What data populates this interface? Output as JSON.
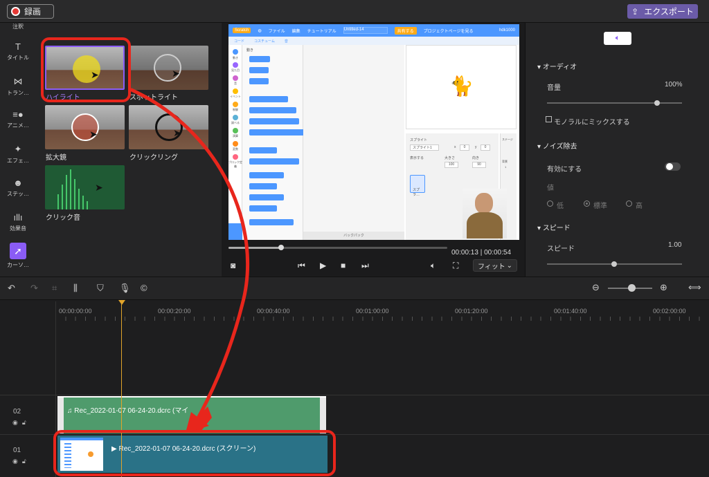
{
  "topbar": {
    "record_label": "録画",
    "export_label": "エクスポート"
  },
  "sidebar": {
    "items": [
      {
        "label": "注釈",
        "icon": "annotation-icon"
      },
      {
        "label": "タイトル",
        "icon": "title-icon"
      },
      {
        "label": "トラン…",
        "icon": "transition-icon"
      },
      {
        "label": "アニメ…",
        "icon": "animation-icon"
      },
      {
        "label": "エフェ…",
        "icon": "effect-icon"
      },
      {
        "label": "ステッ…",
        "icon": "sticker-icon"
      },
      {
        "label": "効果音",
        "icon": "sound-effect-icon"
      },
      {
        "label": "カーソ…",
        "icon": "cursor-icon"
      }
    ]
  },
  "effects": {
    "items": [
      {
        "label": "ハイライト",
        "selected": true
      },
      {
        "label": "スポットライト",
        "selected": false
      },
      {
        "label": "拡大鏡",
        "selected": false
      },
      {
        "label": "クリックリング",
        "selected": false
      },
      {
        "label": "クリック音",
        "selected": false
      }
    ]
  },
  "preview": {
    "scratch": {
      "menu": [
        "ファイル",
        "編集",
        "チュートリアル"
      ],
      "project_title": "Untitled-14",
      "share": "共有する",
      "see_project": "プロジェクトページを見る",
      "user": "hdk1000",
      "tabs": [
        "コード",
        "コスチューム",
        "音"
      ],
      "category_header": "動き",
      "categories": [
        "動き",
        "見た目",
        "音",
        "イベント",
        "制御",
        "調べる",
        "演算",
        "変数",
        "ブロック定義"
      ],
      "backpack": "バックパック",
      "sprite_label": "スプライト",
      "sprite_name": "スプライト1",
      "x_label": "x",
      "x_value": "0",
      "y_label": "y",
      "y_value": "0",
      "show_label": "表示する",
      "size_label": "大きさ",
      "size_value": "100",
      "direction_label": "向き",
      "direction_value": "90",
      "stage_label": "ステージ",
      "backdrop_label": "背景",
      "backdrop_count": "1",
      "thumb_name": "スプラ…"
    },
    "progress": 0.24,
    "time_current": "00:00:13",
    "time_total": "00:00:54",
    "fit_label": "フィット"
  },
  "props": {
    "audio_section": "オーディオ",
    "volume_label": "音量",
    "volume_value": "100%",
    "mono_label": "モノラルにミックスする",
    "noise_section": "ノイズ除去",
    "enable_label": "有効にする",
    "value_label": "値",
    "noise_options": [
      "低",
      "標準",
      "高"
    ],
    "speed_section": "スピード",
    "speed_label": "スピード",
    "speed_value": "1.00"
  },
  "timeline": {
    "ticks": [
      "00:00:00:00",
      "00:00:20:00",
      "00:00:40:00",
      "00:01:00:00",
      "00:01:20:00",
      "00:01:40:00",
      "00:02:00:00"
    ],
    "tracks": [
      {
        "number": "02",
        "clip_title": "Rec_2022-01-07 06-24-20.dcrc (マイ"
      },
      {
        "number": "01",
        "clip_title": "Rec_2022-01-07 06-24-20.dcrc (スクリーン)"
      }
    ]
  },
  "colors": {
    "accent": "#8a5cf5",
    "export": "#6b5ba8",
    "annotation_red": "#e8261c",
    "audio_clip": "#4f9b6c",
    "video_clip": "#2a7287",
    "playhead": "#e2a52b"
  }
}
